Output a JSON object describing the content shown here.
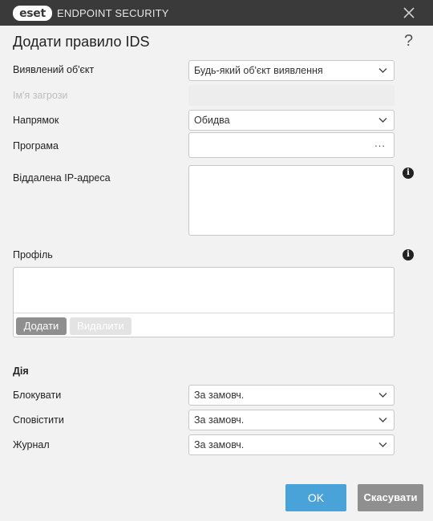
{
  "window": {
    "brand": "eset",
    "product": "ENDPOINT SECURITY",
    "close_icon": "close-icon"
  },
  "page": {
    "title": "Додати правило IDS",
    "help": "?"
  },
  "form": {
    "detected_object": {
      "label": "Виявлений об'єкт",
      "value": "Будь-який об'єкт виявлення"
    },
    "threat_name": {
      "label": "Ім'я загрози",
      "value": ""
    },
    "direction": {
      "label": "Напрямок",
      "value": "Обидва"
    },
    "application": {
      "label": "Програма",
      "value": "",
      "browse": "..."
    },
    "remote_ip": {
      "label": "Віддалена IP-адреса",
      "value": ""
    }
  },
  "profile": {
    "label": "Профіль",
    "add_label": "Додати",
    "remove_label": "Видалити"
  },
  "action": {
    "heading": "Дія",
    "block": {
      "label": "Блокувати",
      "value": "За замовч."
    },
    "notify": {
      "label": "Сповістити",
      "value": "За замовч."
    },
    "log": {
      "label": "Журнал",
      "value": "За замовч."
    }
  },
  "buttons": {
    "ok": "OK",
    "cancel": "Скасувати"
  },
  "colors": {
    "titlebar": "#3a3a3a",
    "accent": "#4aa3d8",
    "secondary_button": "#8f8f8f"
  }
}
